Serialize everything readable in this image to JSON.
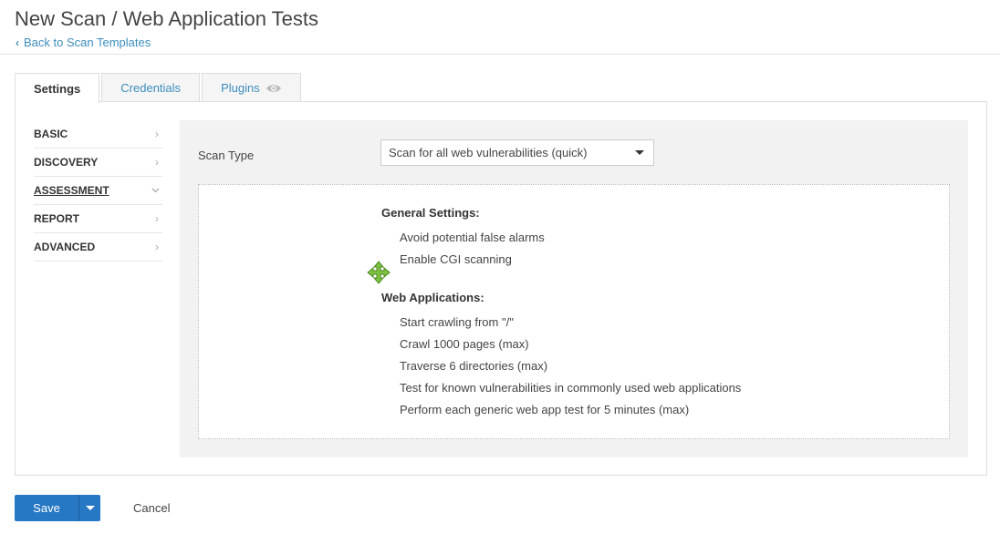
{
  "header": {
    "title": "New Scan / Web Application Tests",
    "back_link": "Back to Scan Templates"
  },
  "tabs": [
    {
      "label": "Settings",
      "active": true
    },
    {
      "label": "Credentials",
      "active": false
    },
    {
      "label": "Plugins",
      "active": false,
      "icon": "eye-icon"
    }
  ],
  "sidebar": {
    "items": [
      {
        "label": "BASIC",
        "selected": false,
        "icon": "chevron-right-icon"
      },
      {
        "label": "DISCOVERY",
        "selected": false,
        "icon": "chevron-right-icon"
      },
      {
        "label": "ASSESSMENT",
        "selected": true,
        "icon": "chevron-down-icon"
      },
      {
        "label": "REPORT",
        "selected": false,
        "icon": "chevron-right-icon"
      },
      {
        "label": "ADVANCED",
        "selected": false,
        "icon": "chevron-right-icon"
      }
    ]
  },
  "assessment": {
    "scan_type_label": "Scan Type",
    "scan_type_value": "Scan for all web vulnerabilities (quick)",
    "general_settings_title": "General Settings:",
    "general_settings": [
      "Avoid potential false alarms",
      "Enable CGI scanning"
    ],
    "web_applications_title": "Web Applications:",
    "web_applications": [
      "Start crawling from \"/\"",
      "Crawl 1000 pages (max)",
      "Traverse 6 directories (max)",
      "Test for known vulnerabilities in commonly used web applications",
      "Perform each generic web app test for 5 minutes (max)"
    ]
  },
  "footer": {
    "save_label": "Save",
    "cancel_label": "Cancel"
  },
  "colors": {
    "accent": "#2778c4",
    "link": "#3c8dbc",
    "move_icon": "#7dc242"
  }
}
